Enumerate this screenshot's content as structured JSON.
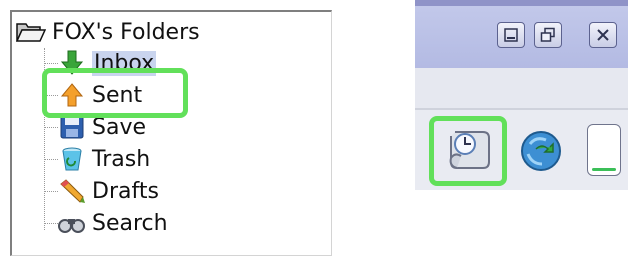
{
  "folder_tree": {
    "root_label": "FOX's Folders",
    "root_icon": "open-folder-icon",
    "items": [
      {
        "label": "Inbox",
        "icon": "inbox-down-arrow-icon",
        "selected": true
      },
      {
        "label": "Sent",
        "icon": "sent-up-arrow-icon",
        "selected": false
      },
      {
        "label": "Save",
        "icon": "save-disk-icon",
        "selected": false
      },
      {
        "label": "Trash",
        "icon": "trash-bin-icon",
        "selected": false
      },
      {
        "label": "Drafts",
        "icon": "drafts-pencil-icon",
        "selected": false
      },
      {
        "label": "Search",
        "icon": "search-binoculars-icon",
        "selected": false
      }
    ],
    "highlighted_item": "Sent"
  },
  "window": {
    "caption_buttons": [
      "minimize-icon",
      "restore-icon",
      "close-icon"
    ]
  },
  "toolbar": {
    "buttons": [
      "clock-scroll-icon",
      "recycle-globe-icon"
    ],
    "highlighted_button": "clock-scroll-icon"
  },
  "colors": {
    "highlight": "#62e05a",
    "selection": "#c9d4ee",
    "titlebar": "#b8bfe6"
  }
}
